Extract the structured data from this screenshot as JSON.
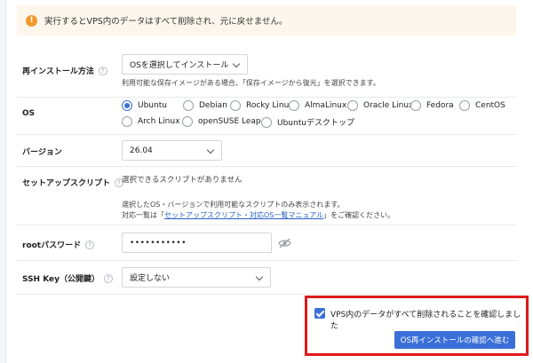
{
  "alert": {
    "icon": "warning-icon",
    "text": "実行するとVPS内のデータはすべて削除され、元に戻せません。"
  },
  "reinstall_method": {
    "label": "再インストール方法",
    "help": "?",
    "selected": "OSを選択してインストール",
    "hint": "利用可能な保存イメージがある場合、「保存イメージから復元」を選択できます。"
  },
  "os": {
    "label": "OS",
    "options": [
      "Ubuntu",
      "Debian",
      "Rocky Linux",
      "AlmaLinux",
      "Oracle Linux",
      "Fedora",
      "CentOS",
      "Arch Linux",
      "openSUSE Leap",
      "Ubuntuデスクトップ"
    ],
    "selected": "Ubuntu"
  },
  "version": {
    "label": "バージョン",
    "selected": "26.04"
  },
  "setup_script": {
    "label": "セットアップスクリプト",
    "help": "?",
    "value": "選択できるスクリプトがありません",
    "hint_line1": "選択したOS・バージョンで利用可能なスクリプトのみ表示されます。",
    "hint_line2_prefix": "対応一覧は「",
    "hint_link": "セットアップスクリプト・対応OS一覧マニュアル",
    "hint_line2_suffix": "」をご確認ください。"
  },
  "root_password": {
    "label": "rootパスワード",
    "help": "?",
    "value": "•••••••••••",
    "toggle_icon": "eye-slash-icon"
  },
  "ssh_key": {
    "label": "SSH Key（公開鍵）",
    "help": "?",
    "selected": "設定しない"
  },
  "confirm": {
    "checkbox_label": "VPS内のデータがすべて削除されることを確認しました",
    "checked": true,
    "button_label": "OS再インストールの確認へ進む"
  },
  "colors": {
    "accent": "#3b6fd8",
    "highlight_border": "#e01a1a",
    "alert_bg": "#fdf6ec",
    "warning": "#f29a2e"
  }
}
